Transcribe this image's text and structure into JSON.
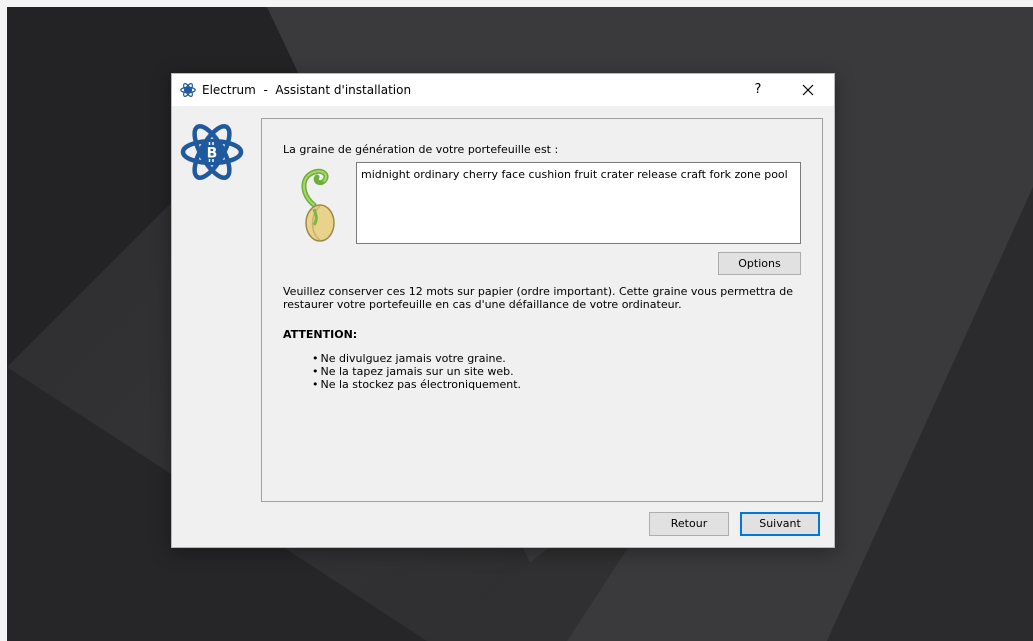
{
  "window": {
    "title": "Electrum  -  Assistant d'installation",
    "help_label": "?",
    "close_label": "×"
  },
  "seed": {
    "heading": "La graine de génération de votre portefeuille est :",
    "words": "midnight ordinary cherry face cushion fruit crater release craft fork zone pool",
    "options_label": "Options"
  },
  "warning": {
    "text": "Veuillez conserver ces 12 mots sur papier (ordre important). Cette graine vous permettra de restaurer votre portefeuille en cas d'une défaillance de votre ordinateur.",
    "attention_title": "ATTENTION:",
    "tips": [
      "Ne divulguez jamais votre graine.",
      "Ne la tapez jamais sur un site web.",
      "Ne la stockez pas électroniquement."
    ]
  },
  "footer": {
    "back_label": "Retour",
    "next_label": "Suivant"
  },
  "icons": {
    "app": "electrum-logo-icon",
    "seed": "seed-sprout-icon",
    "close": "close-icon"
  },
  "colors": {
    "accent": "#0078d7",
    "logo_blue": "#1f5a9e",
    "dialog_bg": "#f0f0f0"
  }
}
